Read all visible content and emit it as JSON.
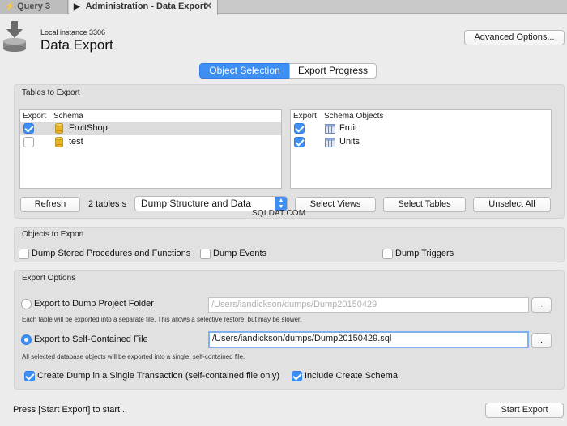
{
  "tabs": [
    {
      "label": "Query 3",
      "icon": "lightning-icon",
      "active": false
    },
    {
      "label": "Administration - Data Export",
      "icon": "play-icon",
      "active": true
    }
  ],
  "header": {
    "instance": "Local instance 3306",
    "title": "Data Export",
    "advanced_button": "Advanced Options..."
  },
  "segments": [
    "Object Selection",
    "Export Progress"
  ],
  "tables_panel": {
    "label": "Tables to Export",
    "schema_list": {
      "headers": [
        "Export",
        "Schema"
      ],
      "rows": [
        {
          "name": "FruitShop",
          "checked": true,
          "selected": true
        },
        {
          "name": "test",
          "checked": false,
          "selected": false
        }
      ]
    },
    "objects_list": {
      "headers": [
        "Export",
        "Schema Objects"
      ],
      "rows": [
        {
          "name": "Fruit",
          "checked": true
        },
        {
          "name": "Units",
          "checked": true
        }
      ]
    },
    "refresh_button": "Refresh",
    "count_label": "2 tables s",
    "dump_select": "Dump Structure and Data",
    "select_views_button": "Select Views",
    "select_tables_button": "Select Tables",
    "unselect_all_button": "Unselect All"
  },
  "watermark": "SQLDAT.COM",
  "objects_panel": {
    "label": "Objects to Export",
    "options": [
      {
        "label": "Dump Stored Procedures and Functions",
        "checked": false
      },
      {
        "label": "Dump Events",
        "checked": false
      },
      {
        "label": "Dump Triggers",
        "checked": false
      }
    ]
  },
  "export_panel": {
    "label": "Export Options",
    "folder_option": {
      "label": "Export to Dump Project Folder",
      "selected": false,
      "path": "/Users/iandickson/dumps/Dump20150429",
      "note": "Each table will be exported into a separate file. This allows a selective restore, but may be slower."
    },
    "file_option": {
      "label": "Export to Self-Contained File",
      "selected": true,
      "path": "/Users/iandickson/dumps/Dump20150429.sql",
      "note": "All selected database objects will be exported into a single, self-contained file."
    },
    "browse_label": "...",
    "single_transaction": {
      "label": "Create Dump in a Single Transaction (self-contained file only)",
      "checked": true
    },
    "include_schema": {
      "label": "Include Create Schema",
      "checked": true
    }
  },
  "footer": {
    "status": "Press [Start Export] to start...",
    "start_button": "Start Export"
  },
  "colors": {
    "accent": "#3d8ff4",
    "panel": "#e1e1e1",
    "window": "#ececec"
  }
}
